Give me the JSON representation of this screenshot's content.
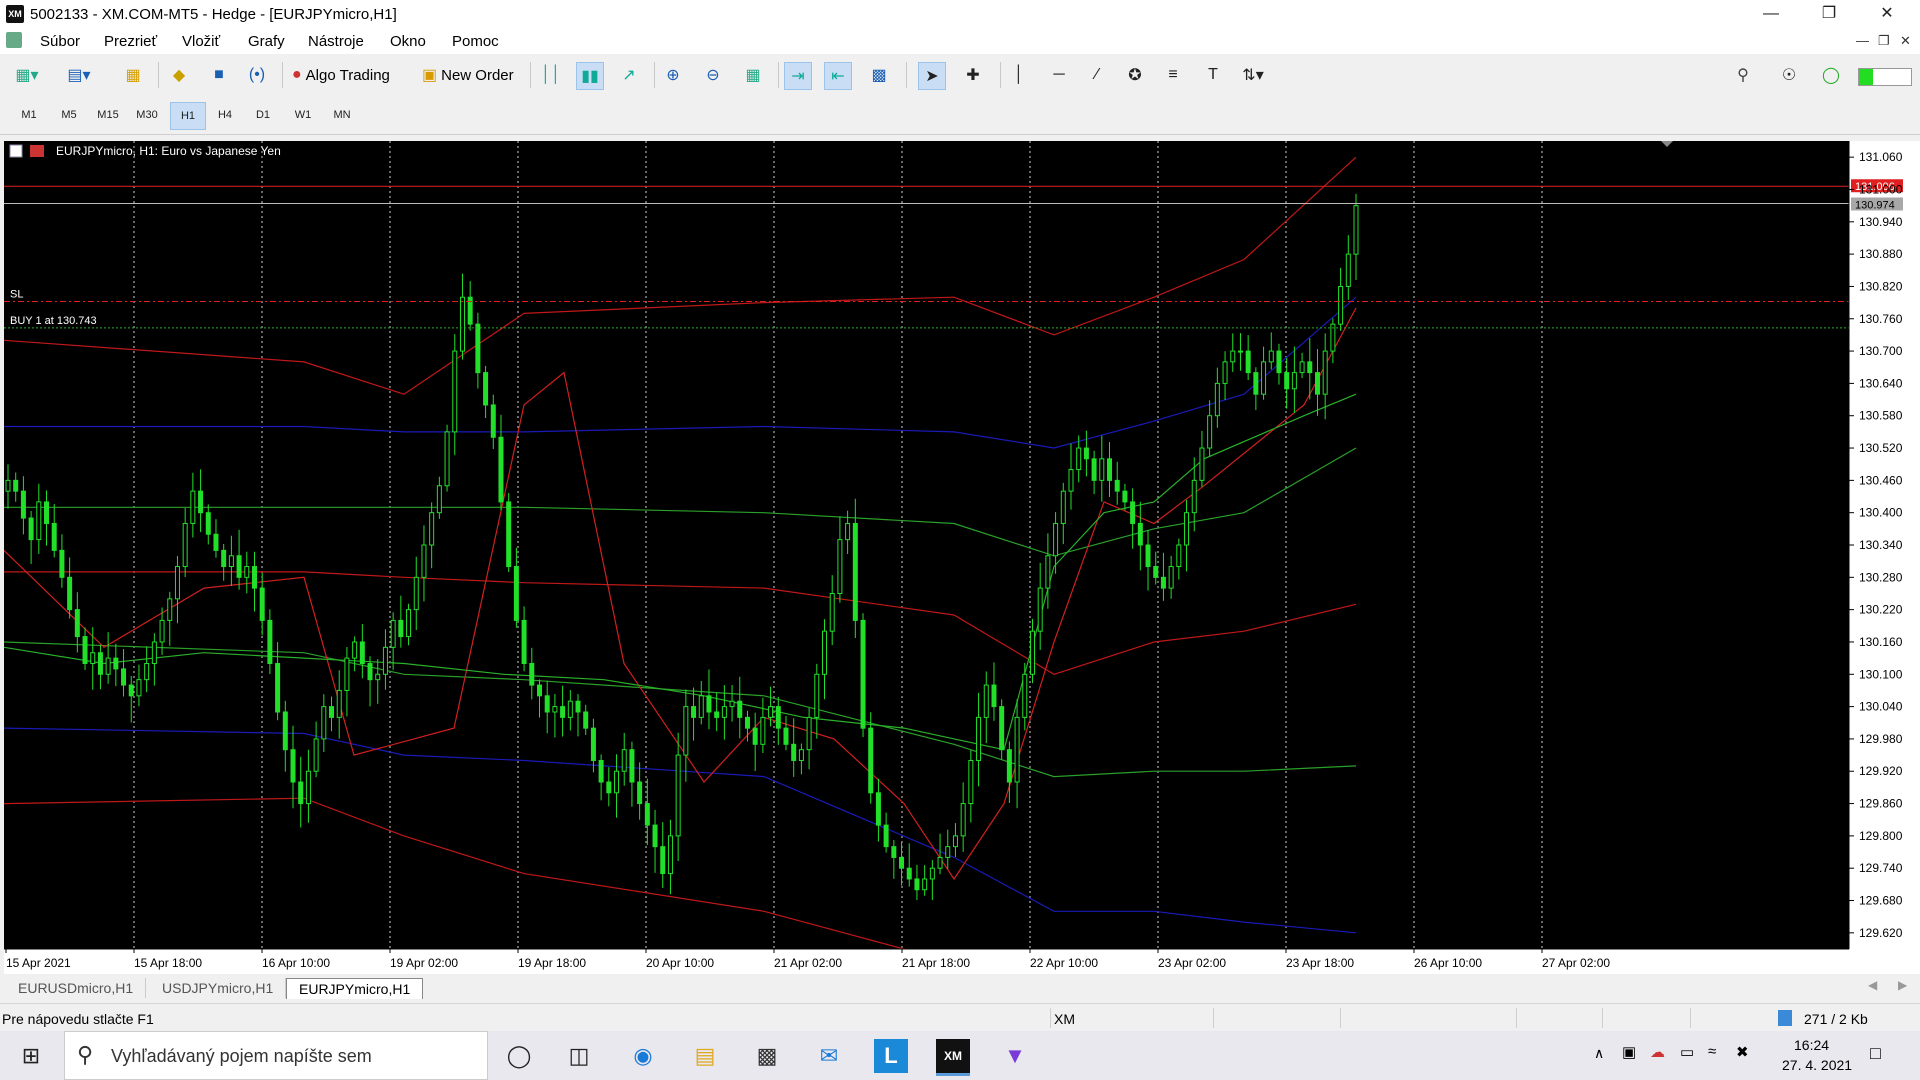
{
  "window": {
    "title": "5002133 - XM.COM-MT5 - Hedge - [EURJPYmicro,H1]",
    "app_icon_text": "XM"
  },
  "menu": [
    "Súbor",
    "Prezrieť",
    "Vložiť",
    "Grafy",
    "Nástroje",
    "Okno",
    "Pomoc"
  ],
  "toolbar": {
    "algo_trading": "Algo Trading",
    "new_order": "New Order"
  },
  "periods": [
    "M1",
    "M5",
    "M15",
    "M30",
    "H1",
    "H4",
    "D1",
    "W1",
    "MN"
  ],
  "active_period": "H1",
  "chart_data": {
    "type": "candlestick",
    "symbol_caption": "EURJPYmicro, H1:  Euro vs Japanese Yen",
    "y_ticks": [
      "131.060",
      "131.000",
      "130.940",
      "130.880",
      "130.820",
      "130.760",
      "130.700",
      "130.640",
      "130.580",
      "130.520",
      "130.460",
      "130.400",
      "130.340",
      "130.280",
      "130.220",
      "130.160",
      "130.100",
      "130.040",
      "129.980",
      "129.920",
      "129.860",
      "129.800",
      "129.740",
      "129.680",
      "129.620"
    ],
    "ylim": [
      129.59,
      131.09
    ],
    "x_ticks": [
      "15 Apr 2021",
      "15 Apr 18:00",
      "16 Apr 10:00",
      "19 Apr 02:00",
      "19 Apr 18:00",
      "20 Apr 10:00",
      "21 Apr 02:00",
      "21 Apr 18:00",
      "22 Apr 10:00",
      "23 Apr 02:00",
      "23 Apr 18:00",
      "26 Apr 10:00",
      "27 Apr 02:00"
    ],
    "ask_label": "131.006",
    "bid_label": "130.974",
    "ask_price": 131.006,
    "bid_price": 130.974,
    "sl_label": "SL",
    "sl_price": 130.792,
    "buy_label": "BUY 1 at 130.743",
    "buy_price": 130.743,
    "grid": true,
    "candle_color": "#22e02a",
    "closes": [
      130.46,
      130.44,
      130.39,
      130.35,
      130.42,
      130.38,
      130.33,
      130.28,
      130.22,
      130.17,
      130.12,
      130.14,
      130.1,
      130.13,
      130.11,
      130.08,
      130.06,
      130.09,
      130.12,
      130.16,
      130.2,
      130.24,
      130.3,
      130.38,
      130.44,
      130.4,
      130.36,
      130.33,
      130.3,
      130.32,
      130.28,
      130.3,
      130.26,
      130.2,
      130.12,
      130.03,
      129.96,
      129.9,
      129.86,
      129.92,
      129.98,
      130.04,
      130.02,
      130.07,
      130.13,
      130.16,
      130.12,
      130.09,
      130.1,
      130.15,
      130.2,
      130.17,
      130.22,
      130.28,
      130.34,
      130.4,
      130.45,
      130.55,
      130.7,
      130.8,
      130.75,
      130.66,
      130.6,
      130.54,
      130.42,
      130.3,
      130.2,
      130.12,
      130.08,
      130.06,
      130.03,
      130.04,
      130.02,
      130.05,
      130.03,
      130.0,
      129.94,
      129.9,
      129.88,
      129.92,
      129.96,
      129.9,
      129.86,
      129.82,
      129.78,
      129.73,
      129.8,
      129.95,
      130.04,
      130.02,
      130.06,
      130.03,
      130.02,
      130.04,
      130.05,
      130.02,
      130.0,
      129.97,
      130.02,
      130.04,
      130.0,
      129.97,
      129.94,
      129.96,
      130.02,
      130.1,
      130.18,
      130.25,
      130.35,
      130.38,
      130.2,
      130.0,
      129.88,
      129.82,
      129.78,
      129.76,
      129.74,
      129.72,
      129.7,
      129.72,
      129.74,
      129.76,
      129.78,
      129.8,
      129.86,
      129.94,
      130.02,
      130.08,
      130.04,
      129.96,
      129.9,
      130.02,
      130.1,
      130.18,
      130.26,
      130.32,
      130.38,
      130.44,
      130.48,
      130.52,
      130.5,
      130.46,
      130.5,
      130.46,
      130.44,
      130.42,
      130.38,
      130.34,
      130.3,
      130.28,
      130.26,
      130.3,
      130.34,
      130.4,
      130.46,
      130.52,
      130.58,
      130.64,
      130.68,
      130.7,
      130.7,
      130.66,
      130.62,
      130.68,
      130.7,
      130.66,
      130.63,
      130.66,
      130.68,
      130.66,
      130.62,
      130.7,
      130.75,
      130.82,
      130.88,
      130.97
    ],
    "band_outer_upper": [
      [
        0,
        130.72
      ],
      [
        300,
        130.68
      ],
      [
        400,
        130.62
      ],
      [
        520,
        130.77
      ],
      [
        760,
        130.79
      ],
      [
        950,
        130.8
      ],
      [
        1050,
        130.73
      ],
      [
        1150,
        130.8
      ],
      [
        1240,
        130.87
      ],
      [
        1352,
        131.06
      ]
    ],
    "band_mid_blue": [
      [
        0,
        130.56
      ],
      [
        300,
        130.56
      ],
      [
        400,
        130.55
      ],
      [
        520,
        130.55
      ],
      [
        760,
        130.56
      ],
      [
        950,
        130.55
      ],
      [
        1050,
        130.52
      ],
      [
        1150,
        130.57
      ],
      [
        1240,
        130.62
      ],
      [
        1352,
        130.8
      ]
    ],
    "band_inner_green_upper": [
      [
        0,
        130.41
      ],
      [
        300,
        130.41
      ],
      [
        400,
        130.41
      ],
      [
        520,
        130.41
      ],
      [
        760,
        130.4
      ],
      [
        950,
        130.38
      ],
      [
        1050,
        130.32
      ],
      [
        1150,
        130.37
      ],
      [
        1240,
        130.4
      ],
      [
        1352,
        130.52
      ]
    ],
    "band_center_red": [
      [
        0,
        130.29
      ],
      [
        300,
        130.29
      ],
      [
        400,
        130.28
      ],
      [
        520,
        130.27
      ],
      [
        760,
        130.26
      ],
      [
        950,
        130.21
      ],
      [
        1050,
        130.1
      ],
      [
        1150,
        130.16
      ],
      [
        1240,
        130.18
      ],
      [
        1352,
        130.23
      ]
    ],
    "band_inner_green_lower": [
      [
        0,
        130.16
      ],
      [
        300,
        130.14
      ],
      [
        400,
        130.1
      ],
      [
        520,
        130.09
      ],
      [
        760,
        130.06
      ],
      [
        950,
        129.97
      ],
      [
        1050,
        129.91
      ],
      [
        1150,
        129.92
      ],
      [
        1240,
        129.92
      ],
      [
        1352,
        129.93
      ]
    ],
    "band_mid_blue_lower": [
      [
        0,
        130.0
      ],
      [
        300,
        129.99
      ],
      [
        400,
        129.95
      ],
      [
        520,
        129.94
      ],
      [
        760,
        129.91
      ],
      [
        950,
        129.76
      ],
      [
        1050,
        129.66
      ],
      [
        1150,
        129.66
      ],
      [
        1240,
        129.64
      ],
      [
        1352,
        129.62
      ]
    ],
    "band_outer_lower": [
      [
        0,
        129.86
      ],
      [
        300,
        129.87
      ],
      [
        400,
        129.8
      ],
      [
        520,
        129.73
      ],
      [
        760,
        129.66
      ],
      [
        900,
        129.59
      ]
    ],
    "ma_red": [
      [
        0,
        130.33
      ],
      [
        100,
        130.15
      ],
      [
        200,
        130.26
      ],
      [
        300,
        130.28
      ],
      [
        350,
        129.95
      ],
      [
        450,
        130.0
      ],
      [
        520,
        130.6
      ],
      [
        560,
        130.66
      ],
      [
        620,
        130.12
      ],
      [
        700,
        129.9
      ],
      [
        760,
        130.02
      ],
      [
        830,
        129.98
      ],
      [
        900,
        129.86
      ],
      [
        950,
        129.72
      ],
      [
        1000,
        129.86
      ],
      [
        1050,
        130.16
      ],
      [
        1100,
        130.42
      ],
      [
        1150,
        130.38
      ],
      [
        1200,
        130.45
      ],
      [
        1300,
        130.6
      ],
      [
        1352,
        130.78
      ]
    ],
    "ma_green_mid": [
      [
        0,
        130.15
      ],
      [
        100,
        130.12
      ],
      [
        200,
        130.14
      ],
      [
        300,
        130.13
      ],
      [
        400,
        130.12
      ],
      [
        500,
        130.1
      ],
      [
        600,
        130.09
      ],
      [
        700,
        130.06
      ],
      [
        800,
        130.02
      ],
      [
        900,
        130.0
      ],
      [
        1000,
        129.96
      ],
      [
        1050,
        130.3
      ],
      [
        1100,
        130.4
      ],
      [
        1150,
        130.42
      ],
      [
        1200,
        130.5
      ],
      [
        1300,
        130.58
      ],
      [
        1352,
        130.62
      ]
    ]
  },
  "chart_tabs": [
    "EURUSDmicro,H1",
    "USDJPYmicro,H1",
    "EURJPYmicro,H1"
  ],
  "active_tab": "EURJPYmicro,H1",
  "status": {
    "help": "Pre nápovedu stlačte F1",
    "profile": "XM",
    "traffic": "271 / 2 Kb"
  },
  "taskbar": {
    "search_placeholder": "Vyhľadávaný pojem napíšte sem",
    "time": "16:24",
    "date": "27. 4. 2021"
  }
}
